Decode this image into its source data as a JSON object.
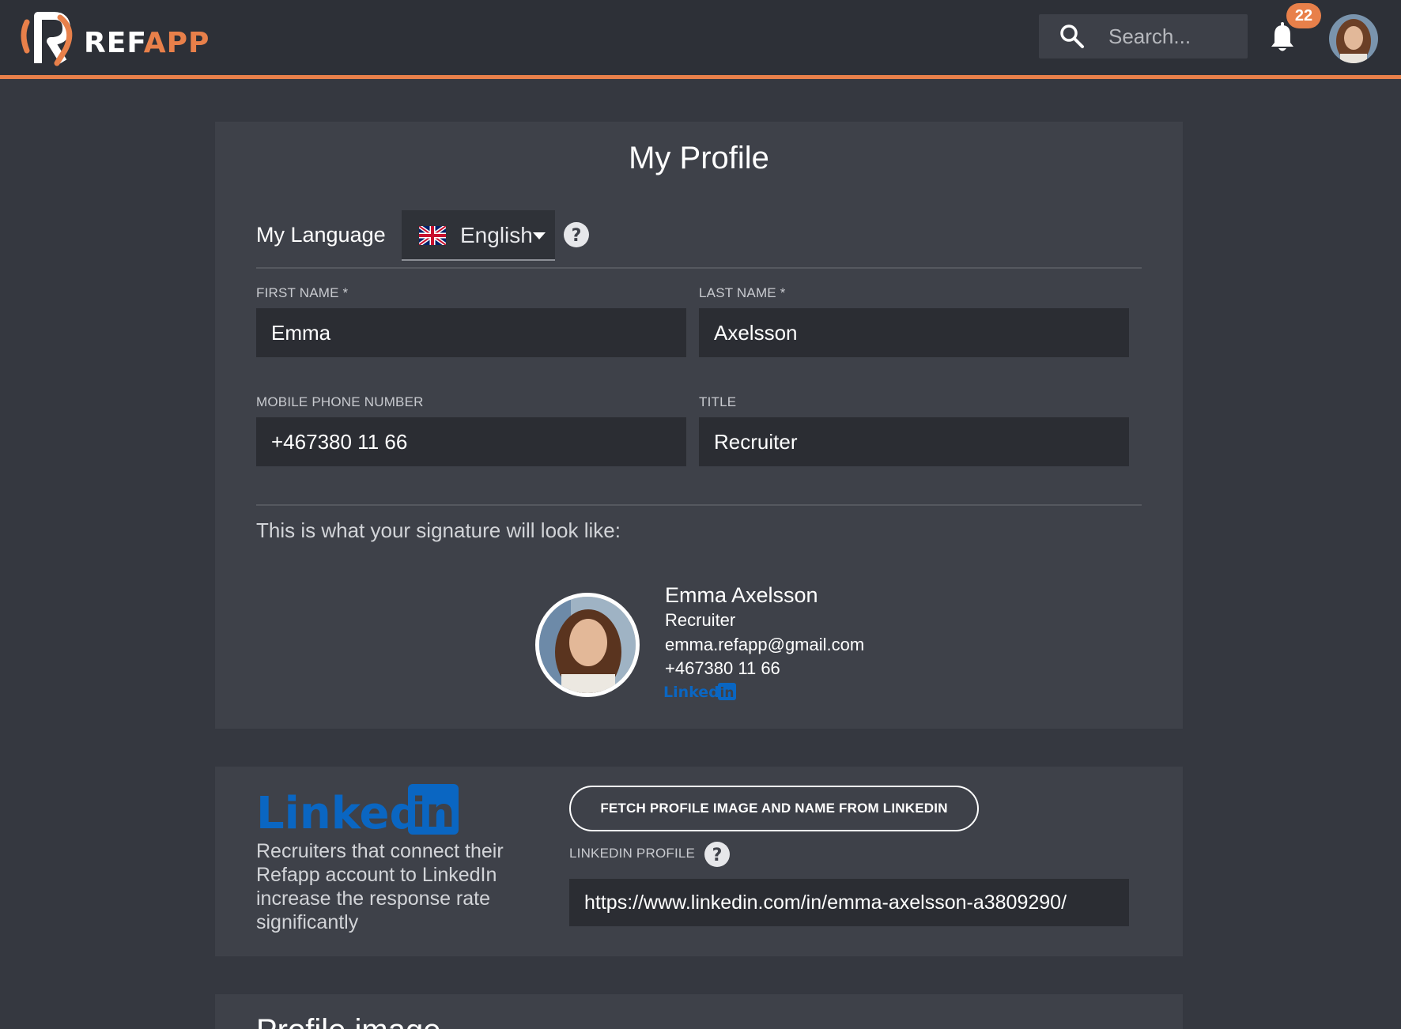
{
  "colors": {
    "accent": "#e8804a",
    "background": "#353840",
    "topbar": "#2d3037",
    "card": "#3e4149",
    "input": "#2b2d33",
    "linkedin": "#0a66c2"
  },
  "header": {
    "logo_ref": "REF",
    "logo_app": "APP",
    "search_placeholder": "Search...",
    "notification_count": "22",
    "icons": [
      "search-icon",
      "bell-icon",
      "avatar"
    ]
  },
  "profile": {
    "title": "My Profile",
    "language_label": "My Language",
    "language_value": "English",
    "first_name_label": "FIRST NAME *",
    "first_name_value": "Emma",
    "last_name_label": "LAST NAME *",
    "last_name_value": "Axelsson",
    "phone_label": "MOBILE PHONE NUMBER",
    "phone_value": "+467380 11 66",
    "title_label": "TITLE",
    "title_value": "Recruiter",
    "signature_caption": "This is what your signature will look like:",
    "signature": {
      "name": "Emma Axelsson",
      "title": "Recruiter",
      "email": "emma.refapp@gmail.com",
      "phone": "+467380 11 66"
    }
  },
  "linkedin": {
    "logo_text": "Linked",
    "logo_in": "in",
    "description": "Recruiters that connect their Refapp account to LinkedIn increase the response rate significantly",
    "fetch_button": "FETCH PROFILE IMAGE AND NAME FROM LINKEDIN",
    "profile_label": "LINKEDIN PROFILE",
    "profile_value": "https://www.linkedin.com/in/emma-axelsson-a3809290/"
  },
  "profile_image": {
    "title": "Profile image"
  }
}
